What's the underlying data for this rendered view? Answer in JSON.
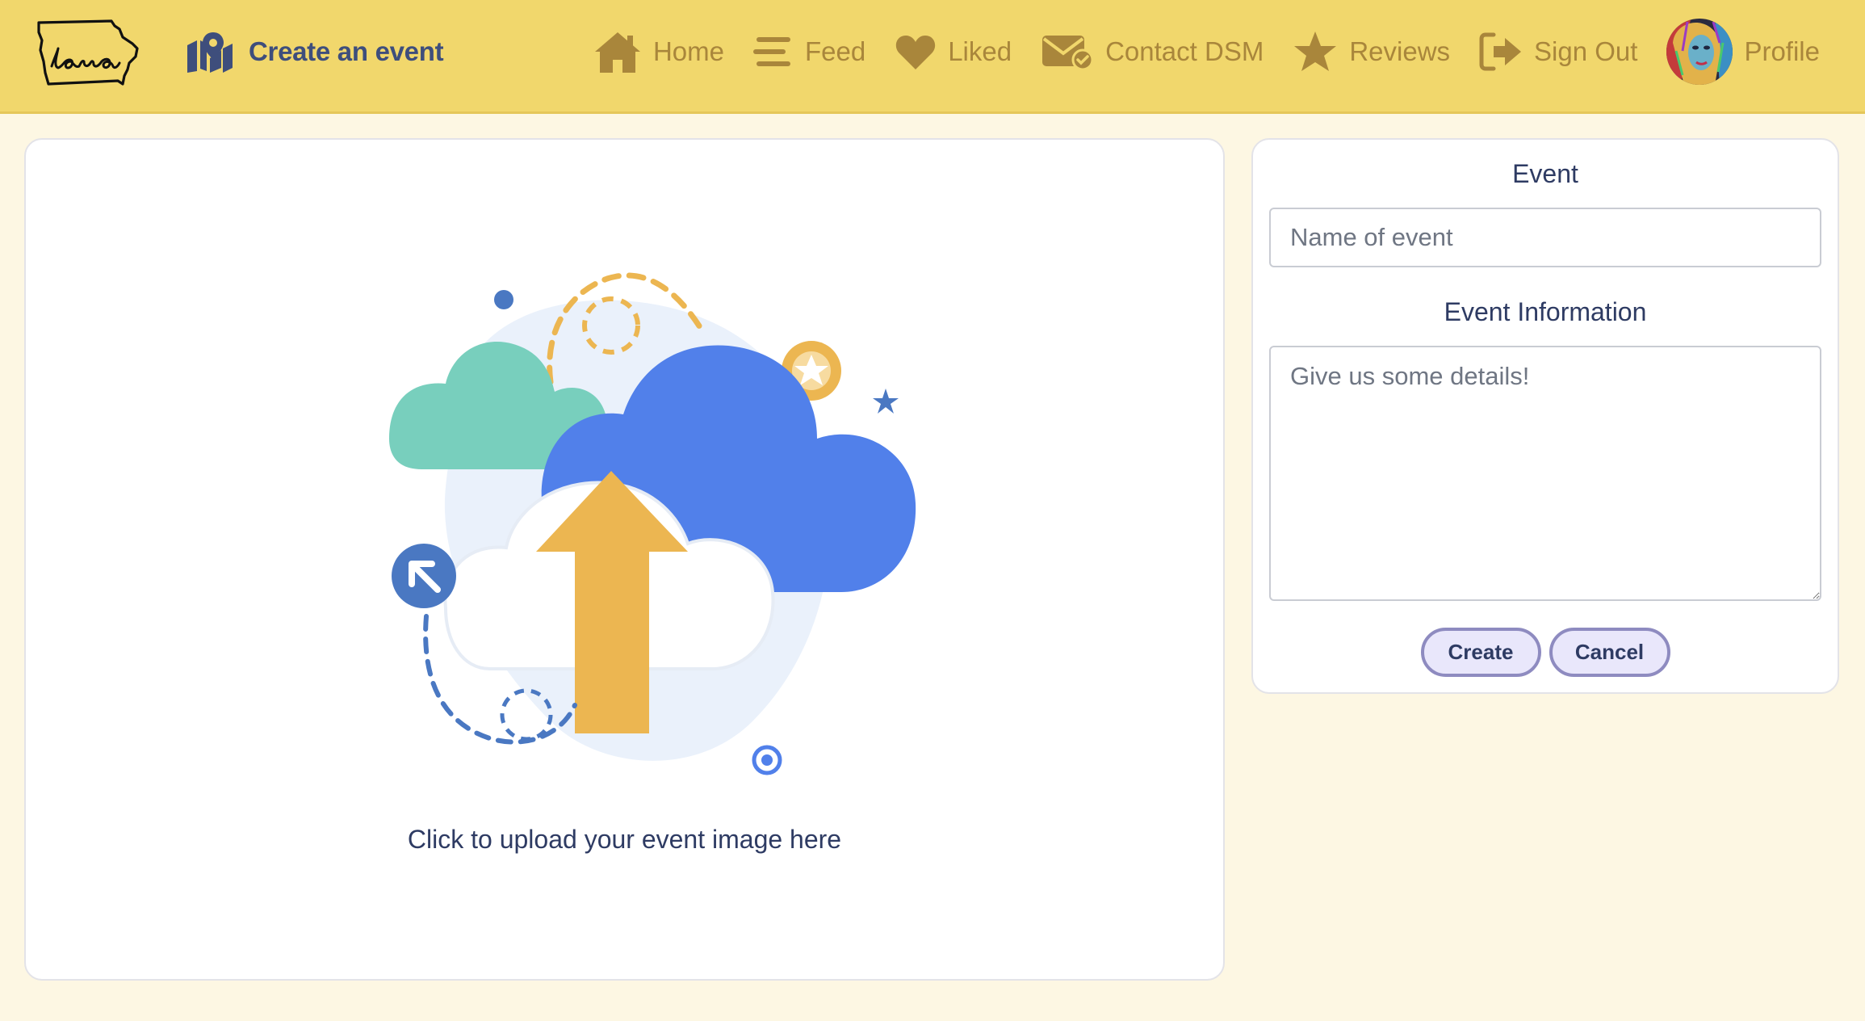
{
  "navbar": {
    "logo_icon": "iowa-state-outline-logo",
    "brand": {
      "label": "Create an event",
      "icon": "map-location-icon"
    },
    "links": [
      {
        "label": "Home",
        "icon": "home-icon"
      },
      {
        "label": "Feed",
        "icon": "menu-lines-icon"
      },
      {
        "label": "Liked",
        "icon": "heart-icon"
      },
      {
        "label": "Contact DSM",
        "icon": "mail-check-icon"
      },
      {
        "label": "Reviews",
        "icon": "star-icon"
      },
      {
        "label": "Sign Out",
        "icon": "sign-out-icon"
      },
      {
        "label": "Profile",
        "icon": "avatar"
      }
    ]
  },
  "upload": {
    "caption": "Click to upload your event image here",
    "illustration": "cloud-upload-illustration"
  },
  "form": {
    "event_label": "Event",
    "event_placeholder": "Name of event",
    "event_value": "",
    "info_label": "Event Information",
    "info_placeholder": "Give us some details!",
    "info_value": "",
    "create_label": "Create",
    "cancel_label": "Cancel"
  },
  "colors": {
    "navbar_bg": "#f1d76c",
    "page_bg": "#fdf7e3",
    "nav_text": "#a9863b",
    "brand_text": "#3e4e7c",
    "text": "#2e3b63",
    "button_bg": "#e9e7fb",
    "button_border": "#8e8bc0",
    "cloud_blue": "#5180ea",
    "cloud_green": "#78cfbd",
    "accent_orange": "#ecb651"
  }
}
